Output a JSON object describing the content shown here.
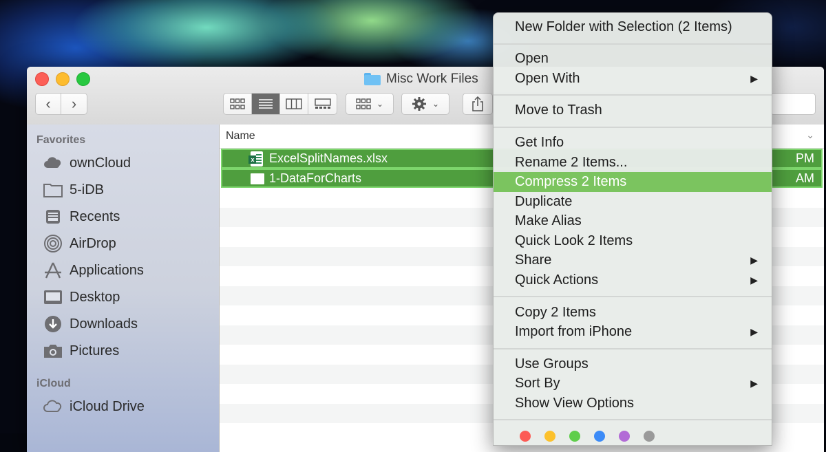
{
  "window": {
    "title": "Misc Work Files",
    "icons": {
      "title": "folder-icon",
      "back": "chevron-left-icon",
      "forward": "chevron-right-icon"
    }
  },
  "toolbar": {
    "view_modes": [
      "icon-view",
      "list-view",
      "column-view",
      "gallery-view"
    ],
    "active_view": "list-view",
    "group_icon": "group-grid-icon",
    "action_icon": "gear-icon",
    "share_icon": "share-icon"
  },
  "sidebar": {
    "favorites_heading": "Favorites",
    "favorites": [
      {
        "label": "ownCloud",
        "icon": "cloud-icon"
      },
      {
        "label": "5-iDB",
        "icon": "folder-icon"
      },
      {
        "label": "Recents",
        "icon": "recents-icon"
      },
      {
        "label": "AirDrop",
        "icon": "airdrop-icon"
      },
      {
        "label": "Applications",
        "icon": "applications-icon"
      },
      {
        "label": "Desktop",
        "icon": "desktop-icon"
      },
      {
        "label": "Downloads",
        "icon": "downloads-icon"
      },
      {
        "label": "Pictures",
        "icon": "camera-icon"
      }
    ],
    "icloud_heading": "iCloud",
    "icloud": [
      {
        "label": "iCloud Drive",
        "icon": "cloud-outline-icon"
      }
    ]
  },
  "file_list": {
    "name_header": "Name",
    "files": [
      {
        "name": "ExcelSplitNames.xlsx",
        "date_fragment": "PM",
        "icon": "excel-file-icon",
        "selected": true
      },
      {
        "name": "1-DataForCharts",
        "date_fragment": "AM",
        "icon": "document-icon",
        "selected": true
      }
    ]
  },
  "context_menu": {
    "items": [
      {
        "label": "New Folder with Selection (2 Items)"
      },
      {
        "label": "Open"
      },
      {
        "label": "Open With",
        "submenu": true
      },
      {
        "label": "Move to Trash"
      },
      {
        "label": "Get Info"
      },
      {
        "label": "Rename 2 Items..."
      },
      {
        "label": "Compress 2 Items",
        "highlighted": true
      },
      {
        "label": "Duplicate"
      },
      {
        "label": "Make Alias"
      },
      {
        "label": "Quick Look 2 Items"
      },
      {
        "label": "Share",
        "submenu": true
      },
      {
        "label": "Quick Actions",
        "submenu": true
      },
      {
        "label": "Copy 2 Items"
      },
      {
        "label": "Import from iPhone",
        "submenu": true
      },
      {
        "label": "Use Groups"
      },
      {
        "label": "Sort By",
        "submenu": true
      },
      {
        "label": "Show View Options"
      }
    ],
    "submenu_arrow": "▶",
    "tag_colors": [
      "#fc5b55",
      "#fcc12c",
      "#5fce4b",
      "#3c8bf7",
      "#b26bd6",
      "#9a9a9a"
    ]
  },
  "colors": {
    "selection": "#4f9e3e",
    "menu_highlight": "#7bc45f"
  }
}
